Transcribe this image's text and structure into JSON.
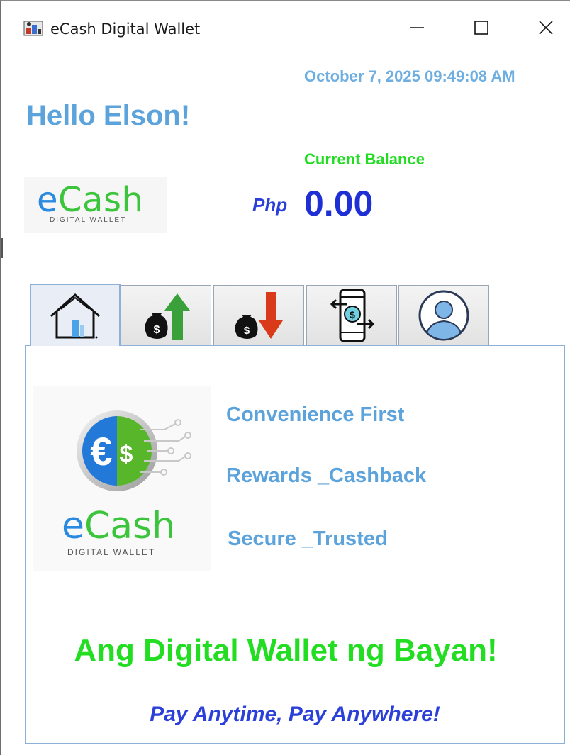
{
  "window": {
    "title": "eCash Digital Wallet",
    "controls": {
      "minimize": "minimize-icon",
      "maximize": "maximize-icon",
      "close": "close-icon"
    }
  },
  "header": {
    "datetime": "October 7, 2025 09:49:08 AM",
    "greeting": "Hello Elson!",
    "balance_label": "Current Balance",
    "currency": "Php",
    "balance": "0.00"
  },
  "brand": {
    "logo_word_e": "e",
    "logo_word_cash": "Cash",
    "logo_sub": "DIGITAL WALLET"
  },
  "tabs": [
    {
      "icon": "home-icon",
      "active": true
    },
    {
      "icon": "cash-in-icon",
      "active": false
    },
    {
      "icon": "cash-out-icon",
      "active": false
    },
    {
      "icon": "transfer-icon",
      "active": false
    },
    {
      "icon": "profile-icon",
      "active": false
    }
  ],
  "home": {
    "features": [
      "Convenience First",
      "Rewards _Cashback",
      "Secure _Trusted"
    ],
    "tagline": "Ang Digital Wallet ng Bayan!",
    "motto": "Pay Anytime, Pay Anywhere!"
  },
  "colors": {
    "accent_blue": "#5ca3dc",
    "accent_green": "#22dd22",
    "balance_blue": "#1f2fd6",
    "logo_green": "#3cc43c",
    "logo_blue": "#2a8ae0"
  }
}
